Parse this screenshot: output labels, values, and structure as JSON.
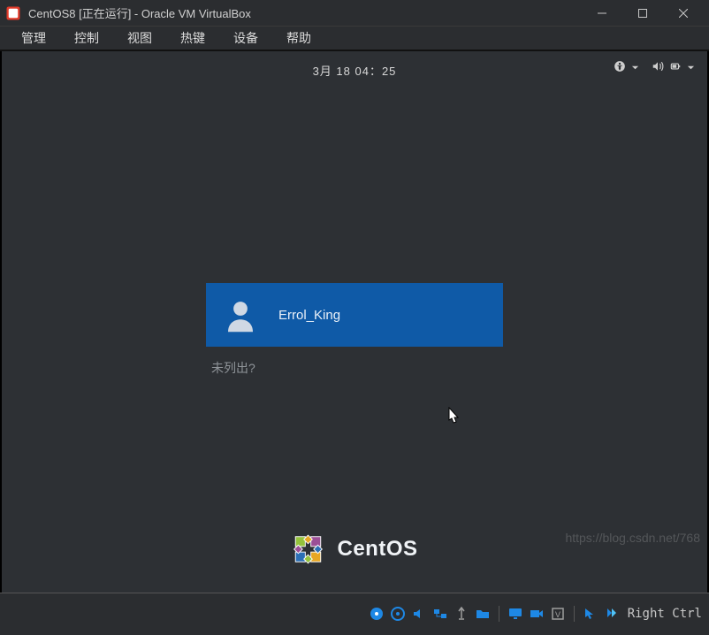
{
  "titlebar": {
    "title": "CentOS8 [正在运行] - Oracle VM VirtualBox"
  },
  "menubar": {
    "items": [
      "管理",
      "控制",
      "视图",
      "热键",
      "设备",
      "帮助"
    ]
  },
  "gnome": {
    "clock": "3月 18 04：25"
  },
  "login": {
    "username": "Errol_King",
    "not_listed": "未列出?"
  },
  "brand": {
    "name": "CentOS"
  },
  "statusbar": {
    "host_key": "Right Ctrl"
  },
  "watermark": "https://blog.csdn.net/768"
}
